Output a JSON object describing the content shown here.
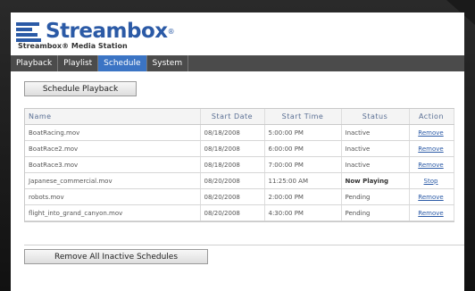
{
  "brand": {
    "name": "Streambox",
    "reg": "®",
    "subtitle": "Streambox® Media Station",
    "color": "#2b5aa6"
  },
  "tabs": [
    {
      "label": "Playback",
      "active": false
    },
    {
      "label": "Playlist",
      "active": false
    },
    {
      "label": "Schedule",
      "active": true
    },
    {
      "label": "System",
      "active": false
    }
  ],
  "schedule_button": "Schedule Playback",
  "table": {
    "headers": [
      "Name",
      "Start Date",
      "Start Time",
      "Status",
      "Action"
    ],
    "rows": [
      {
        "name": "BoatRacing.mov",
        "date": "08/18/2008",
        "time": "5:00:00 PM",
        "status": "Inactive",
        "action": "Remove"
      },
      {
        "name": "BoatRace2.mov",
        "date": "08/18/2008",
        "time": "6:00:00 PM",
        "status": "Inactive",
        "action": "Remove"
      },
      {
        "name": "BoatRace3.mov",
        "date": "08/18/2008",
        "time": "7:00:00 PM",
        "status": "Inactive",
        "action": "Remove"
      },
      {
        "name": "Japanese_commercial.mov",
        "date": "08/20/2008",
        "time": "11:25:00 AM",
        "status": "Now Playing",
        "action": "Stop"
      },
      {
        "name": "robots.mov",
        "date": "08/20/2008",
        "time": "2:00:00 PM",
        "status": "Pending",
        "action": "Remove"
      },
      {
        "name": "flight_into_grand_canyon.mov",
        "date": "08/20/2008",
        "time": "4:30:00 PM",
        "status": "Pending",
        "action": "Remove"
      }
    ]
  },
  "remove_all_button": "Remove All Inactive Schedules",
  "colors": {
    "tab_bar": "#4b4b4b",
    "tab_active": "#3b74c4",
    "link": "#2b5aa6"
  }
}
